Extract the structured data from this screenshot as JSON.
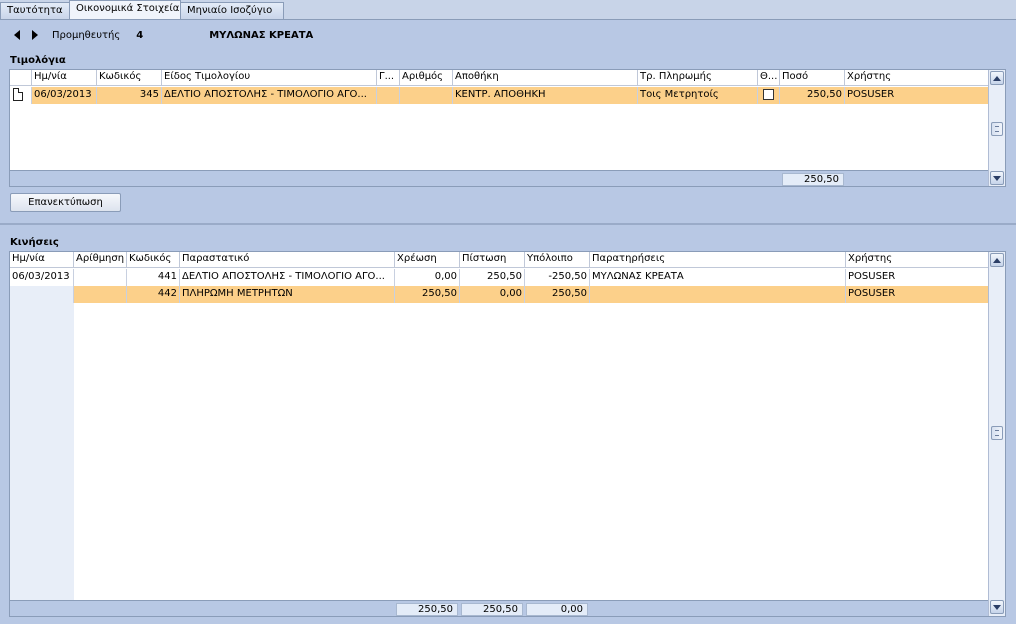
{
  "tabs": [
    {
      "label": "Ταυτότητα",
      "active": false
    },
    {
      "label": "Οικονομικά Στοιχεία",
      "active": true
    },
    {
      "label": "Μηνιαίο Ισοζύγιο",
      "active": false
    }
  ],
  "nav": {
    "supplier_label": "Προμηθευτής",
    "supplier_code": "4",
    "supplier_name": "ΜΥΛΩΝΑΣ ΚΡΕΑΤΑ"
  },
  "invoices": {
    "title": "Τιμολόγια",
    "columns": [
      "Ημ/νία",
      "Κωδικός",
      "Είδος Τιμολογίου",
      "Γ...",
      "Αριθμός",
      "Αποθήκη",
      "Τρ. Πληρωμής",
      "Θ...",
      "Ποσό",
      "Χρήστης"
    ],
    "rows": [
      {
        "date": "06/03/2013",
        "code": "345",
        "type": "ΔΕΛΤΙΟ ΑΠΟΣΤΟΛΗΣ - ΤΙΜΟΛΟΓΙΟ ΑΓΟ...",
        "g": "",
        "number": "",
        "warehouse": "ΚΕΝΤΡ. ΑΠΟΘΗΚΗ",
        "payment": "Τοις Μετρητοίς",
        "checked": false,
        "amount": "250,50",
        "user": "POSUSER"
      }
    ],
    "total": "250,50",
    "reprint_label": "Επανεκτύπωση"
  },
  "movements": {
    "title": "Κινήσεις",
    "columns": [
      "Ημ/νία",
      "Αρίθμηση",
      "Κωδικός",
      "Παραστατικό",
      "Χρέωση",
      "Πίστωση",
      "Υπόλοιπο",
      "Παρατηρήσεις",
      "Χρήστης"
    ],
    "rows": [
      {
        "date": "06/03/2013",
        "numbering": "",
        "code": "441",
        "doc": "ΔΕΛΤΙΟ ΑΠΟΣΤΟΛΗΣ - ΤΙΜΟΛΟΓΙΟ ΑΓΟ...",
        "debit": "0,00",
        "credit": "250,50",
        "balance": "-250,50",
        "notes": "ΜΥΛΩΝΑΣ ΚΡΕΑΤΑ",
        "user": "POSUSER"
      },
      {
        "date": "",
        "numbering": "",
        "code": "442",
        "doc": "ΠΛΗΡΩΜΗ ΜΕΤΡΗΤΩΝ",
        "debit": "250,50",
        "credit": "0,00",
        "balance": "250,50",
        "notes": "",
        "user": "POSUSER"
      }
    ],
    "totals": {
      "debit": "250,50",
      "credit": "250,50",
      "balance": "0,00"
    }
  },
  "colors": {
    "selected_row": "#fcd08a",
    "panel": "#b8c8e4"
  }
}
